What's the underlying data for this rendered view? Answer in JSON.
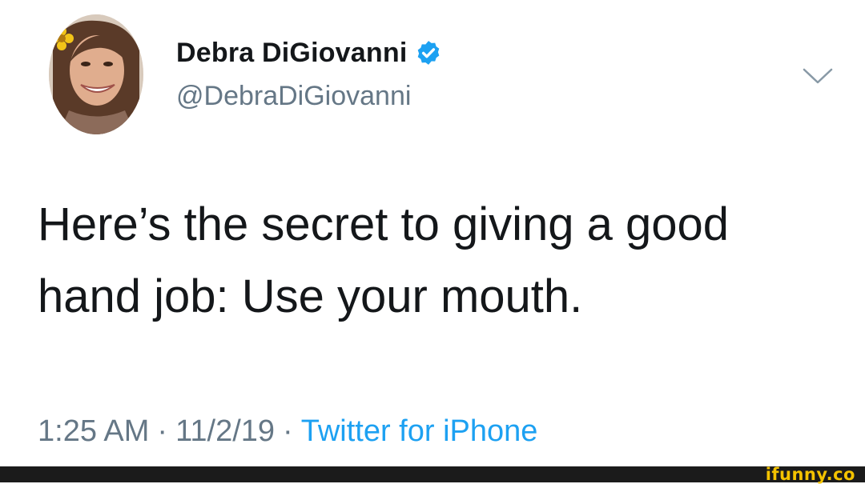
{
  "author": {
    "display_name": "Debra DiGiovanni",
    "handle": "@DebraDiGiovanni",
    "verified": true,
    "avatar_icon": "profile-photo"
  },
  "tweet": {
    "text_lines": [
      "Here’s the secret to giving a good",
      "hand job: Use your mouth."
    ],
    "time": "1:25 AM",
    "date": "11/2/19",
    "source": "Twitter for iPhone",
    "separator": "·"
  },
  "menu_icon": "chevron-down-icon",
  "watermark": "ifunny.co",
  "colors": {
    "text": "#14171a",
    "secondary_text": "#657786",
    "link": "#1da1f2",
    "verified_badge": "#1da1f2",
    "footer_bar": "#1b1b1b",
    "watermark": "#f4c300"
  }
}
